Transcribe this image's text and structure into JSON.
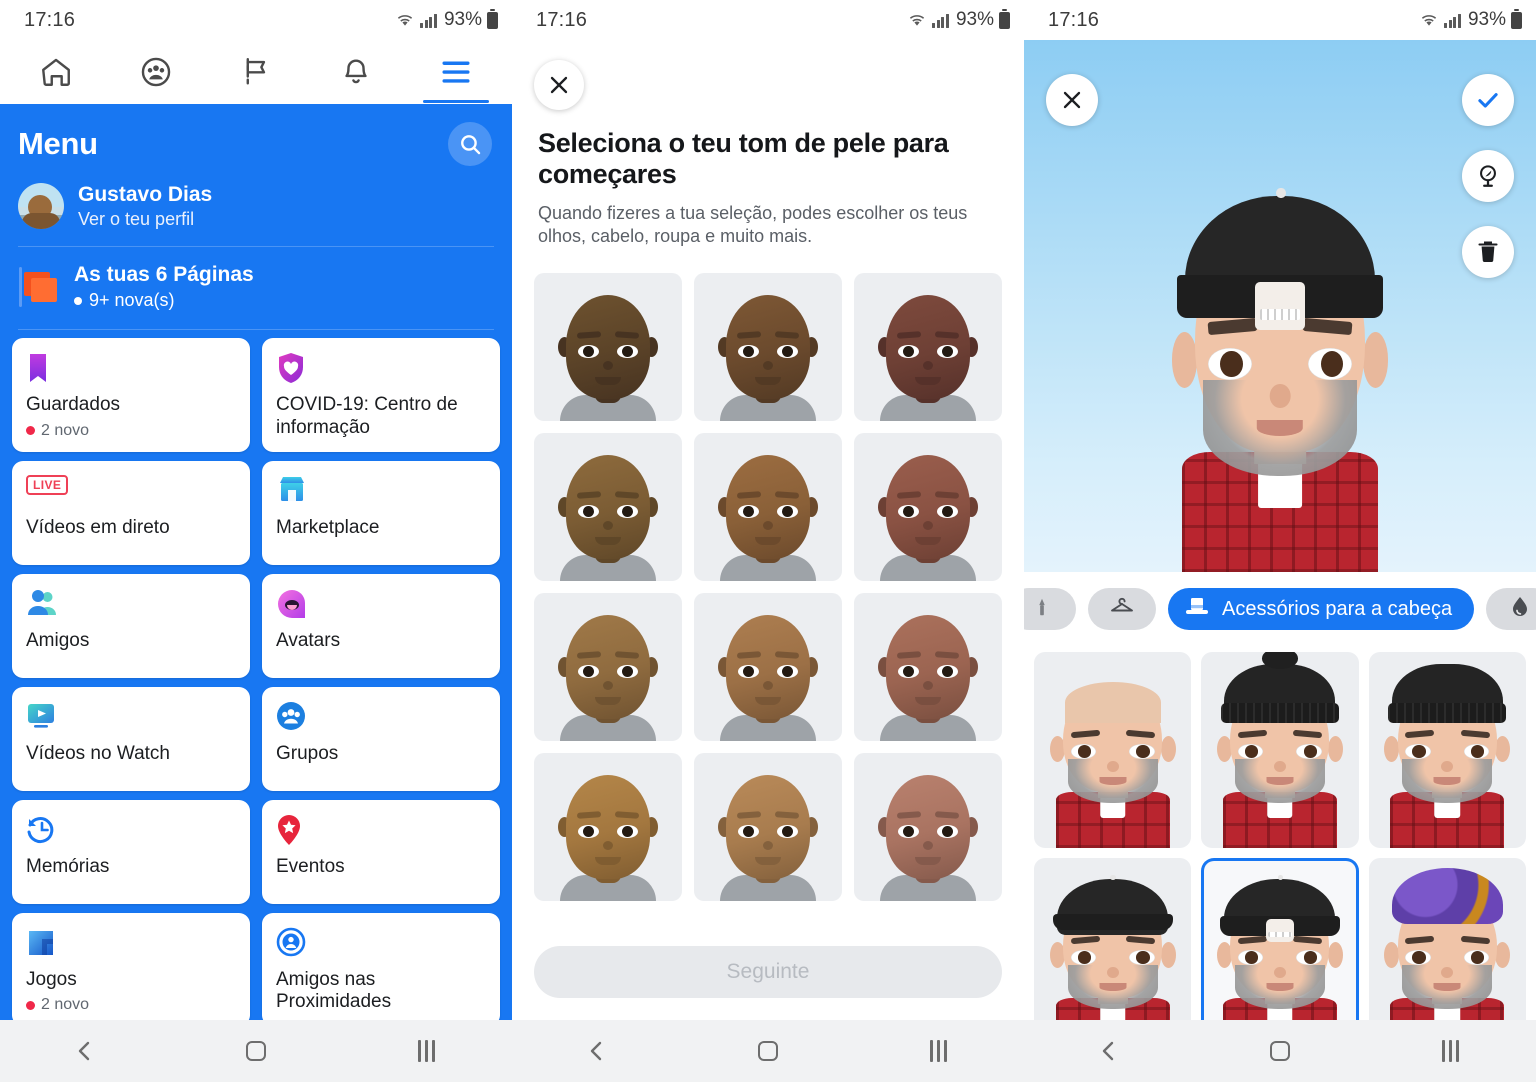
{
  "status_bar": {
    "time": "17:16",
    "battery": "93%",
    "wifi_icon": "wifi-icon",
    "signal_icon": "cellular-signal-icon",
    "battery_icon": "battery-icon"
  },
  "panel1": {
    "top_nav": [
      {
        "name": "home-icon",
        "label": "Início"
      },
      {
        "name": "groups-icon",
        "label": "Grupos"
      },
      {
        "name": "pages-flag-icon",
        "label": "Páginas"
      },
      {
        "name": "notifications-bell-icon",
        "label": "Notificações"
      },
      {
        "name": "hamburger-menu-icon",
        "label": "Menu",
        "active": true
      }
    ],
    "menu_title": "Menu",
    "search_icon": "search-icon",
    "profile": {
      "name": "Gustavo Dias",
      "subtitle": "Ver o teu perfil",
      "avatar": "profile-avatar"
    },
    "pages": {
      "title": "As tuas 6 Páginas",
      "badge": "9+ nova(s)",
      "icon": "pages-flag-icon"
    },
    "tiles": [
      {
        "label": "Guardados",
        "badge": "2 novo",
        "icon": "bookmark-icon",
        "color": "#A33EA1"
      },
      {
        "label": "COVID-19: Centro de informação",
        "badge": "",
        "icon": "shield-heart-icon",
        "color": "#C21FB3"
      },
      {
        "label": "Vídeos em direto",
        "badge": "",
        "icon": "live-badge-icon",
        "color": "#EF4056"
      },
      {
        "label": "Marketplace",
        "badge": "",
        "icon": "storefront-icon",
        "color": "#30A3E6"
      },
      {
        "label": "Amigos",
        "badge": "",
        "icon": "friends-icon",
        "color": "#2E89E5"
      },
      {
        "label": "Avatars",
        "badge": "",
        "icon": "avatar-face-icon",
        "color": "#E946C8"
      },
      {
        "label": "Vídeos no Watch",
        "badge": "",
        "icon": "watch-play-icon",
        "color": "#2DB6E0"
      },
      {
        "label": "Grupos",
        "badge": "",
        "icon": "groups-circle-icon",
        "color": "#1C7FE0"
      },
      {
        "label": "Memórias",
        "badge": "",
        "icon": "memories-clock-icon",
        "color": "#1877F2"
      },
      {
        "label": "Eventos",
        "badge": "",
        "icon": "event-pin-icon",
        "color": "#E7253C"
      },
      {
        "label": "Jogos",
        "badge": "2 novo",
        "icon": "games-icon",
        "color": "#1A73E8"
      },
      {
        "label": "Amigos nas Proximidades",
        "badge": "",
        "icon": "nearby-friends-icon",
        "color": "#1877F2"
      }
    ]
  },
  "panel2": {
    "close_icon": "close-x-icon",
    "title": "Seleciona o teu tom de pele para começares",
    "subtitle": "Quando fizeres a tua seleção, podes escolher os teus olhos, cabelo, roupa e muito mais.",
    "skin_tones": [
      {
        "id": "tone-1",
        "skin": "#5b4328",
        "shadow": "#473321",
        "light": "#6e522f"
      },
      {
        "id": "tone-2",
        "skin": "#6b4a2d",
        "shadow": "#533a24",
        "light": "#7e5835"
      },
      {
        "id": "tone-3",
        "skin": "#6e4035",
        "shadow": "#56312a",
        "light": "#7e4a3d"
      },
      {
        "id": "tone-4",
        "skin": "#7b5c34",
        "shadow": "#5f4728",
        "light": "#8e6b3d"
      },
      {
        "id": "tone-5",
        "skin": "#8a6038",
        "shadow": "#6c4a2c",
        "light": "#9c6d41"
      },
      {
        "id": "tone-6",
        "skin": "#8a5243",
        "shadow": "#6d4034",
        "light": "#9a5e4d"
      },
      {
        "id": "tone-7",
        "skin": "#8f6b3f",
        "shadow": "#705331",
        "light": "#a07948"
      },
      {
        "id": "tone-8",
        "skin": "#9c7046",
        "shadow": "#7a5736",
        "light": "#ad7e50"
      },
      {
        "id": "tone-9",
        "skin": "#9b6451",
        "shadow": "#7a4f40",
        "light": "#ab715c"
      },
      {
        "id": "tone-10",
        "skin": "#a3773f",
        "shadow": "#805d31",
        "light": "#b48649"
      },
      {
        "id": "tone-11",
        "skin": "#a87c4e",
        "shadow": "#84613d",
        "light": "#b98a59"
      },
      {
        "id": "tone-12",
        "skin": "#a97361",
        "shadow": "#855a4c",
        "light": "#b9816e"
      }
    ],
    "next_button": "Seguinte"
  },
  "panel3": {
    "close_icon": "close-x-icon",
    "confirm_icon": "checkmark-icon",
    "mirror_icon": "mirror-flip-icon",
    "delete_icon": "trash-icon",
    "categories": [
      {
        "id": "cat-peek",
        "icon": "previous-category-icon",
        "label": "",
        "active": false,
        "peek": true
      },
      {
        "id": "cat-clothes",
        "icon": "hanger-icon",
        "label": "",
        "active": false
      },
      {
        "id": "cat-head-accessories",
        "icon": "top-hat-icon",
        "label": "Acessórios para a cabeça",
        "active": true
      },
      {
        "id": "cat-color",
        "icon": "droplet-icon",
        "label": "",
        "active": false
      }
    ],
    "options": [
      {
        "id": "opt-none",
        "accessory": "none",
        "selected": false
      },
      {
        "id": "opt-beanie-pom",
        "accessory": "beanie-pom",
        "selected": false
      },
      {
        "id": "opt-beanie",
        "accessory": "beanie",
        "selected": false
      },
      {
        "id": "opt-cap-forward",
        "accessory": "cap-forward",
        "selected": false
      },
      {
        "id": "opt-cap-backward",
        "accessory": "cap-backward",
        "selected": true
      },
      {
        "id": "opt-turban",
        "accessory": "turban",
        "selected": false
      }
    ]
  },
  "android_nav": {
    "back_icon": "back-chevron-icon",
    "home_icon": "home-square-icon",
    "recents_icon": "recent-apps-icon"
  },
  "colors": {
    "facebook_blue": "#1877F2",
    "menu_blue": "#1877F2",
    "selected_border": "#1877F2",
    "red_dot": "#F02849"
  }
}
